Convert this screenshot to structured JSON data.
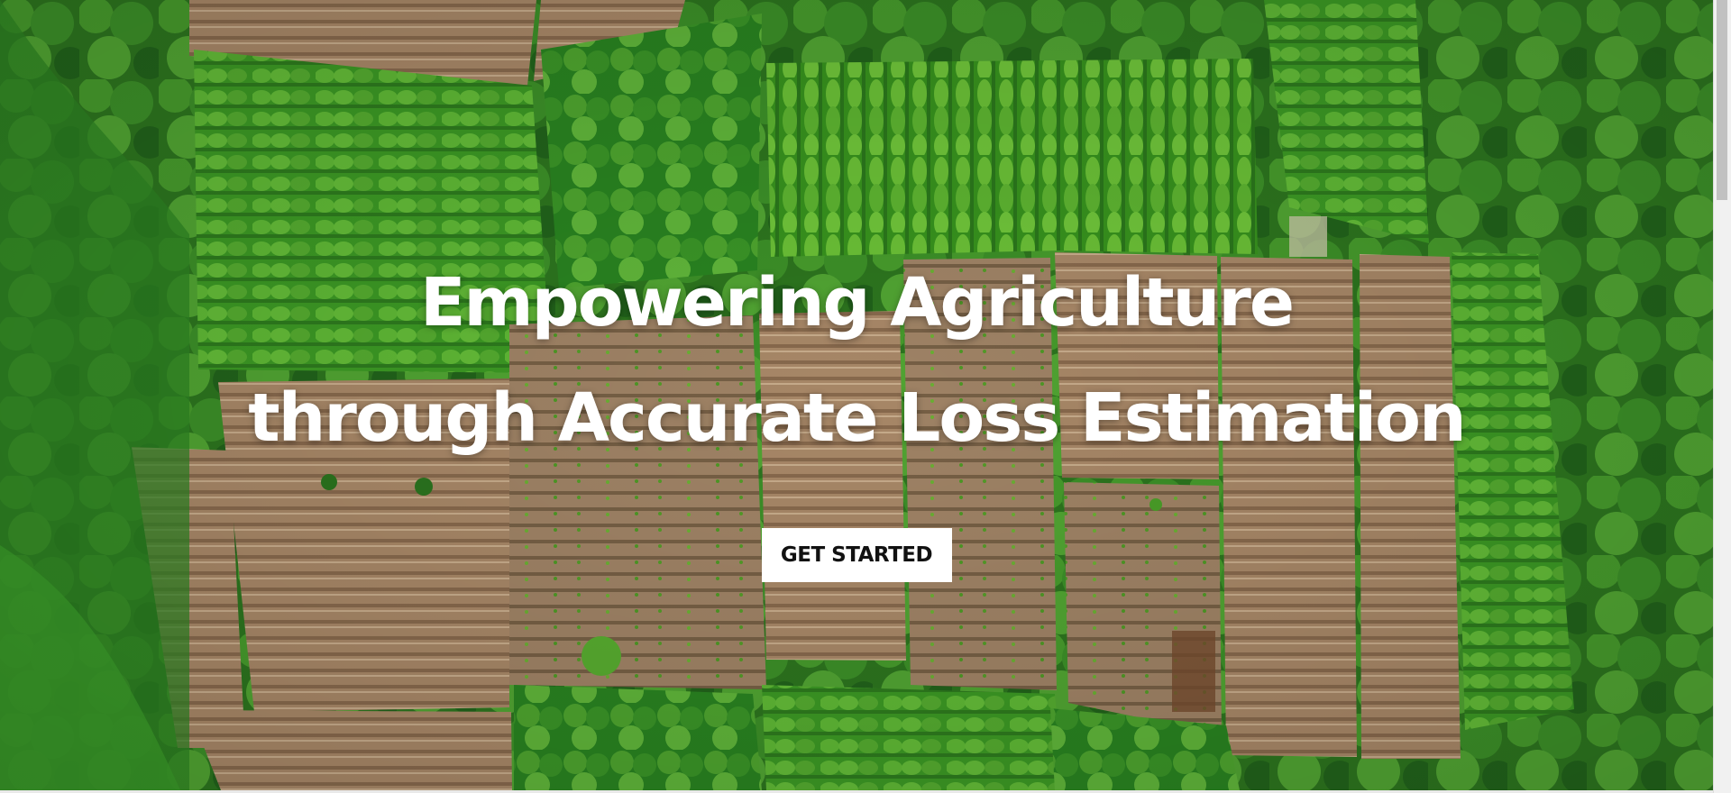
{
  "hero": {
    "title_line_1": "Empowering Agriculture",
    "title_line_2": "through Accurate Loss Estimation",
    "cta_label": "GET STARTED",
    "background_image": "aerial-farmland-photo"
  },
  "colors": {
    "title": "#ffffff",
    "button_background": "#ffffff",
    "button_text": "#111111",
    "foliage_dark": "#1f5f17",
    "foliage_bright": "#58b22f",
    "soil": "#a98767"
  },
  "scrollbar": {
    "position": "top"
  }
}
